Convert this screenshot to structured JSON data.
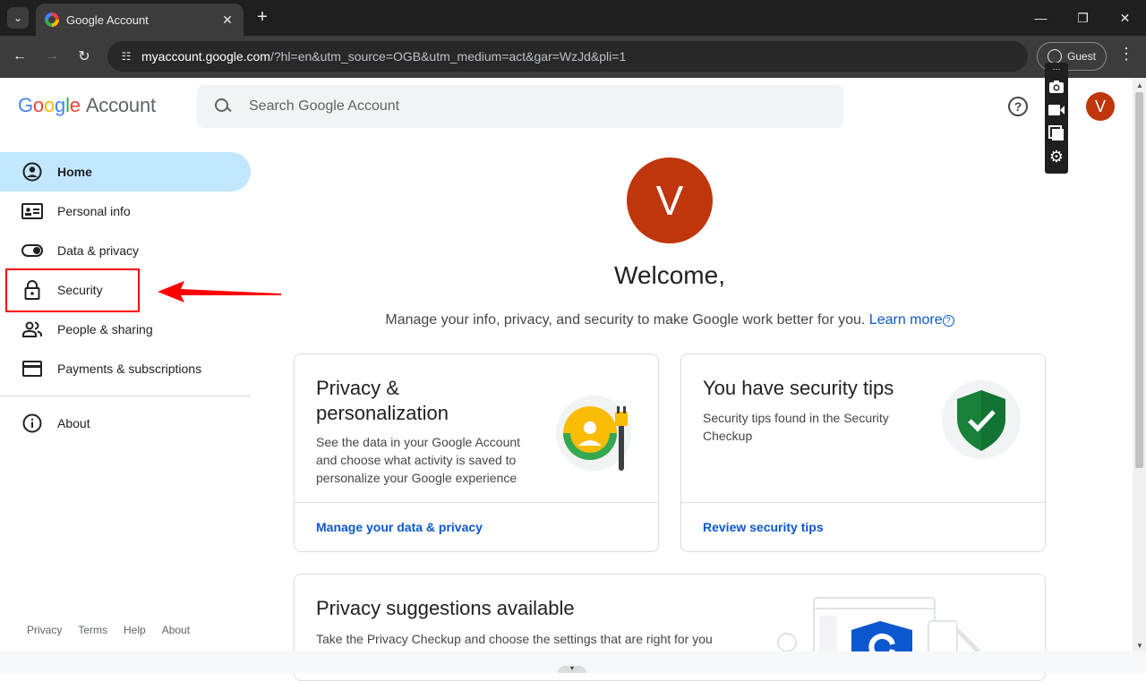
{
  "browser": {
    "tab_title": "Google Account",
    "url_host": "myaccount.google.com",
    "url_path": "/?hl=en&utm_source=OGB&utm_medium=act&gar=WzJd&pli=1",
    "profile_label": "Guest"
  },
  "header": {
    "logo_word": "Google",
    "logo_suffix": "Account",
    "search_placeholder": "Search Google Account",
    "avatar_letter": "V"
  },
  "sidebar": {
    "items": [
      {
        "label": "Home",
        "icon": "account-circle-icon"
      },
      {
        "label": "Personal info",
        "icon": "id-card-icon"
      },
      {
        "label": "Data & privacy",
        "icon": "toggle-icon"
      },
      {
        "label": "Security",
        "icon": "lock-icon"
      },
      {
        "label": "People & sharing",
        "icon": "people-icon"
      },
      {
        "label": "Payments & subscriptions",
        "icon": "credit-card-icon"
      },
      {
        "label": "About",
        "icon": "info-icon"
      }
    ],
    "active_index": 0,
    "footer": [
      "Privacy",
      "Terms",
      "Help",
      "About"
    ]
  },
  "main": {
    "avatar_letter": "V",
    "welcome": "Welcome,",
    "subtitle": "Manage your info, privacy, and security to make Google work better for you.",
    "learn_more": "Learn more",
    "cards": [
      {
        "title_line1": "Privacy &",
        "title_line2": "personalization",
        "desc_lines": [
          "See the data in your Google Account",
          "and choose what activity is saved to",
          "personalize your Google experience"
        ],
        "link": "Manage your data & privacy"
      },
      {
        "title": "You have security tips",
        "desc_lines": [
          "Security tips found in the Security",
          "Checkup"
        ],
        "link": "Review security tips"
      },
      {
        "title": "Privacy suggestions available",
        "desc": "Take the Privacy Checkup and choose the settings that are right for you"
      }
    ]
  },
  "colors": {
    "accent": "#0b57d0",
    "active_nav": "#c2e7ff",
    "avatar": "#bf360c",
    "annotation": "#ff0000"
  }
}
